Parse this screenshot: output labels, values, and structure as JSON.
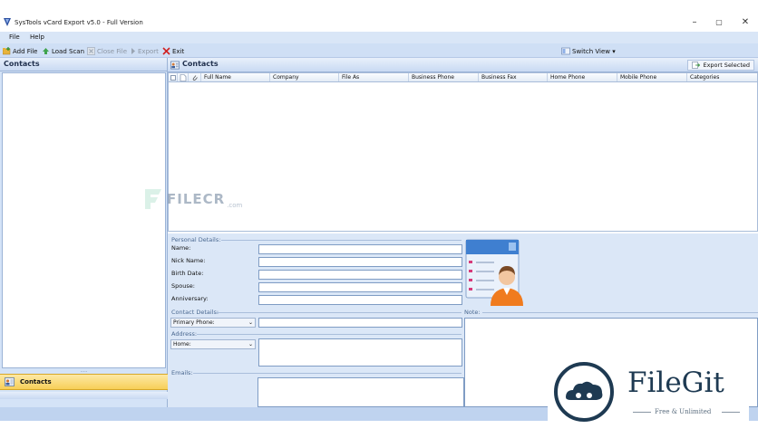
{
  "window": {
    "title": "SysTools vCard Export v5.0 - Full Version",
    "minimize": "–",
    "maximize": "▢",
    "close": "✕"
  },
  "menu": [
    "File",
    "Help"
  ],
  "toolbar": {
    "add_file": "Add File",
    "load_scan": "Load Scan",
    "close_file": "Close File",
    "export": "Export",
    "exit": "Exit",
    "switch_view": "Switch View ▾"
  },
  "left_panel": {
    "header": "Contacts",
    "nav_item": "Contacts",
    "splitter": "....."
  },
  "right_panel": {
    "header": "Contacts",
    "export_selected": "Export Selected",
    "columns": [
      "Full Name",
      "Company",
      "File As",
      "Business Phone",
      "Business Fax",
      "Home Phone",
      "Mobile Phone",
      "Categories"
    ]
  },
  "details": {
    "personal_group": "Personal Details:",
    "fields": [
      "Name:",
      "Nick Name:",
      "Birth Date:",
      "Spouse:",
      "Anniversary:"
    ],
    "contact_group": "Contact Details:",
    "phone_select": "Primary Phone:",
    "address_group": "Address:",
    "address_select": "Home:",
    "emails_group": "Emails:",
    "note_group": "Note:"
  },
  "watermarks": {
    "filecr_name": "FILECR",
    "filecr_domain": ".com",
    "filegit_name": "FileGit",
    "filegit_tagline": "Free & Unlimited"
  },
  "colors": {
    "ribbon": "#cfdff5",
    "panel": "#d4e3f7",
    "selected_nav": "#f7cf58",
    "avatar_shirt": "#f07b1e"
  }
}
